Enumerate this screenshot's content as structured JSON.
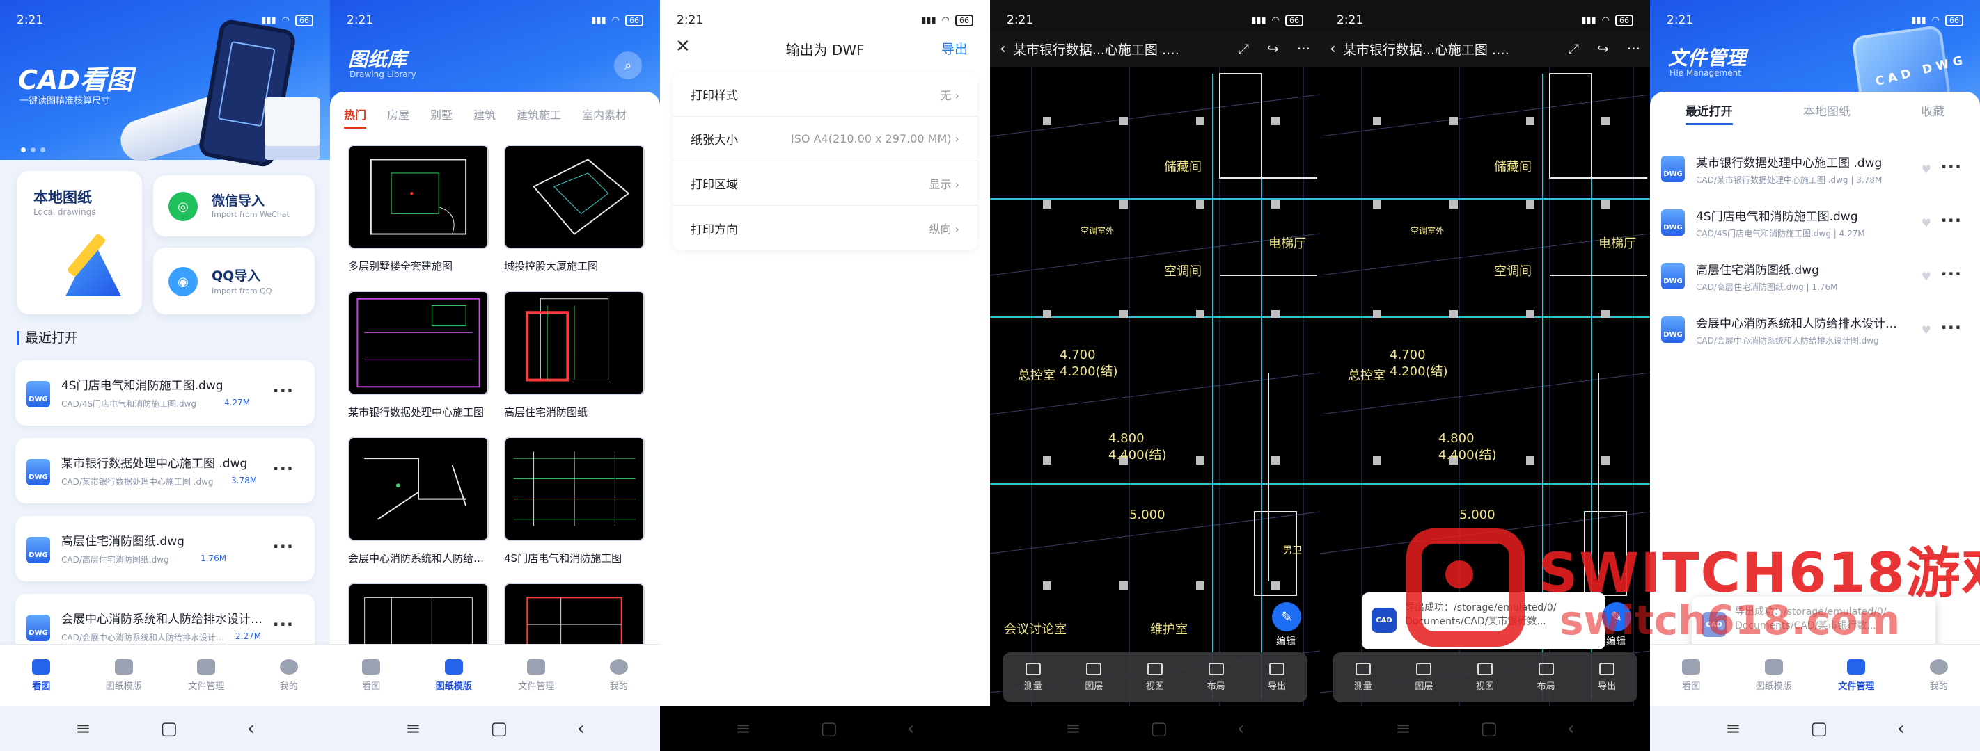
{
  "time": "2:21",
  "battery": "66",
  "bottom_tabs": [
    "看图",
    "图纸模版",
    "文件管理",
    "我的"
  ],
  "home": {
    "title": "CAD看图",
    "subtitle": "一键读图精准核算尺寸",
    "local": {
      "title": "本地图纸",
      "subtitle": "Local drawings"
    },
    "wechat": {
      "title": "微信导入",
      "subtitle": "Import from WeChat"
    },
    "qq": {
      "title": "QQ导入",
      "subtitle": "Import from QQ"
    },
    "recent_title": "最近打开",
    "files": [
      {
        "name": "4S门店电气和消防施工图.dwg",
        "path": "CAD/4S门店电气和消防施工图.dwg",
        "size": "4.27M"
      },
      {
        "name": "某市银行数据处理中心施工图 .dwg",
        "path": "CAD/某市银行数据处理中心施工图 .dwg",
        "size": "3.78M"
      },
      {
        "name": "高层住宅消防图纸.dwg",
        "path": "CAD/高层住宅消防图纸.dwg",
        "size": "1.76M"
      },
      {
        "name": "会展中心消防系统和人防给排水设计图.dwg",
        "path": "CAD/会展中心消防系统和人防给排水设计图.dwg",
        "size": "2.27M"
      }
    ]
  },
  "library": {
    "title": "图纸库",
    "subtitle": "Drawing Library",
    "categories": [
      "热门",
      "房屋",
      "别墅",
      "建筑",
      "建筑施工",
      "室内素材"
    ],
    "items": [
      "多层别墅楼全套建施图",
      "城投控股大厦施工图",
      "某市银行数据处理中心施工图",
      "高层住宅消防图纸",
      "会展中心消防系统和人防给排水设计图",
      "4S门店电气和消防施工图"
    ]
  },
  "export_dialog": {
    "title": "输出为 DWF",
    "export_label": "导出",
    "close_icon": "close-icon",
    "rows": [
      {
        "label": "打印样式",
        "value": "无"
      },
      {
        "label": "纸张大小",
        "value": "ISO A4(210.00 x 297.00 MM)"
      },
      {
        "label": "打印区域",
        "value": "显示"
      },
      {
        "label": "打印方向",
        "value": "纵向"
      }
    ]
  },
  "viewer": {
    "file_name": "某市银行数据...心施工图 .dwg",
    "tools": [
      "测量",
      "图层",
      "视图",
      "布局",
      "导出"
    ],
    "edit_label": "编辑",
    "cad_texts": [
      "储藏间",
      "空调间",
      "空调室外",
      "总控室",
      "4.700",
      "4.200(结)",
      "4.800",
      "4.400(结)",
      "5.000",
      "电梯厅",
      "维护室",
      "会议讨论室",
      "男卫"
    ],
    "toast_line1": "导出成功：/storage/emulated/0/",
    "toast_line2": "Documents/CAD/某市银行数..."
  },
  "file_manager": {
    "title": "文件管理",
    "subtitle": "File Management",
    "tabs": [
      "最近打开",
      "本地图纸",
      "收藏"
    ],
    "files": [
      {
        "name": "某市银行数据处理中心施工图 .dwg",
        "path": "CAD/某市银行数据处理中心施工图 .dwg | 3.78M"
      },
      {
        "name": "4S门店电气和消防施工图.dwg",
        "path": "CAD/4S门店电气和消防施工图.dwg | 4.27M"
      },
      {
        "name": "高层住宅消防图纸.dwg",
        "path": "CAD/高层住宅消防图纸.dwg | 1.76M"
      },
      {
        "name": "会展中心消防系统和人防给排水设计图.dwg",
        "path": "CAD/会展中心消防系统和人防给排水设计图.dwg"
      }
    ]
  },
  "watermark": {
    "line1": "SWITCH618游戏",
    "line2": "switch618.com"
  },
  "colors": {
    "primary": "#2563eb",
    "accent_red": "#e1361b",
    "cad_bg": "#000000"
  }
}
